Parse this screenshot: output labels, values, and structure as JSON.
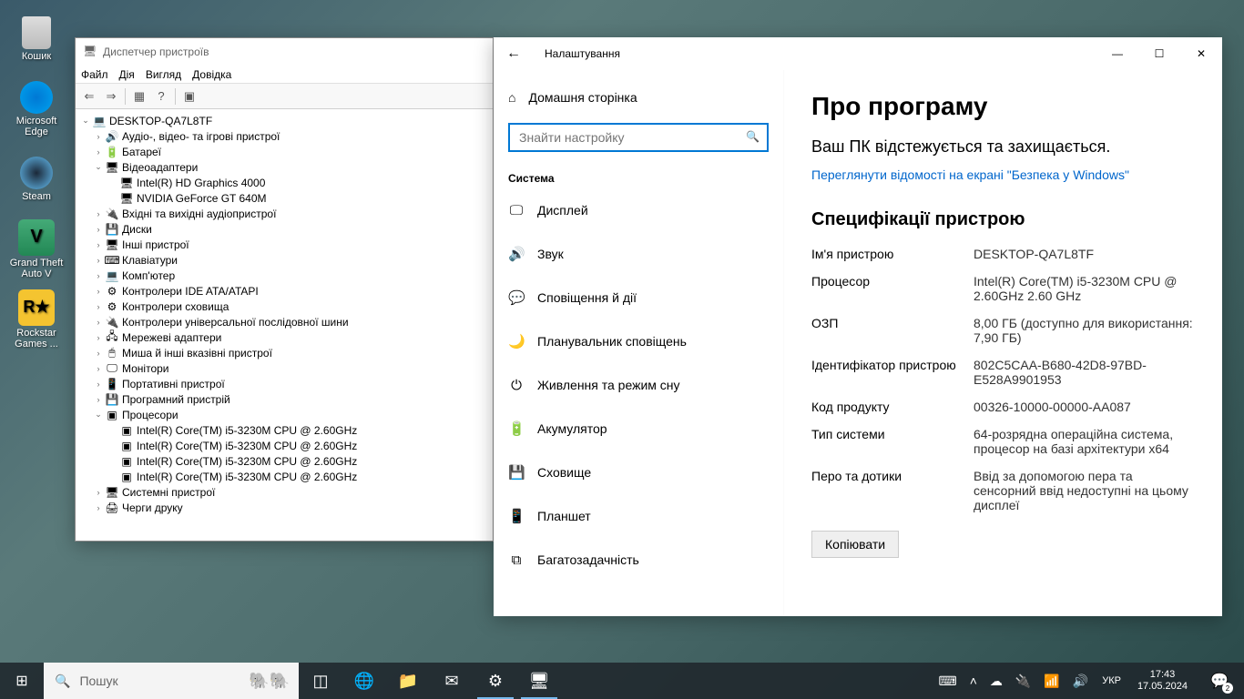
{
  "desktop": {
    "icons": [
      {
        "name": "trash",
        "label": "Кошик",
        "glyph": ""
      },
      {
        "name": "edge",
        "label": "Microsoft Edge",
        "glyph": ""
      },
      {
        "name": "steam",
        "label": "Steam",
        "glyph": ""
      },
      {
        "name": "gta",
        "label": "Grand Theft Auto V",
        "glyph": "V"
      },
      {
        "name": "rockstar",
        "label": "Rockstar Games ...",
        "glyph": "R★"
      }
    ]
  },
  "devmgr": {
    "title": "Диспетчер пристроїв",
    "menu": [
      "Файл",
      "Дія",
      "Вигляд",
      "Довідка"
    ],
    "root": "DESKTOP-QA7L8TF",
    "categories": [
      {
        "arrow": "›",
        "icon": "🔊",
        "label": "Аудіо-, відео- та ігрові пристрої",
        "children": []
      },
      {
        "arrow": "›",
        "icon": "🔋",
        "label": "Батареї",
        "children": []
      },
      {
        "arrow": "⌄",
        "icon": "🖥",
        "label": "Відеоадаптери",
        "children": [
          {
            "icon": "🖥",
            "label": "Intel(R) HD Graphics 4000"
          },
          {
            "icon": "🖥",
            "label": "NVIDIA GeForce GT 640M"
          }
        ]
      },
      {
        "arrow": "›",
        "icon": "🔌",
        "label": "Вхідні та вихідні аудіопристрої",
        "children": []
      },
      {
        "arrow": "›",
        "icon": "💾",
        "label": "Диски",
        "children": []
      },
      {
        "arrow": "›",
        "icon": "🖥",
        "label": "Інші пристрої",
        "children": []
      },
      {
        "arrow": "›",
        "icon": "⌨",
        "label": "Клавіатури",
        "children": []
      },
      {
        "arrow": "›",
        "icon": "💻",
        "label": "Комп'ютер",
        "children": []
      },
      {
        "arrow": "›",
        "icon": "⚙",
        "label": "Контролери IDE ATA/ATAPI",
        "children": []
      },
      {
        "arrow": "›",
        "icon": "⚙",
        "label": "Контролери сховища",
        "children": []
      },
      {
        "arrow": "›",
        "icon": "🔌",
        "label": "Контролери універсальної послідовної шини",
        "children": []
      },
      {
        "arrow": "›",
        "icon": "🖧",
        "label": "Мережеві адаптери",
        "children": []
      },
      {
        "arrow": "›",
        "icon": "🖱",
        "label": "Миша й інші вказівні пристрої",
        "children": []
      },
      {
        "arrow": "›",
        "icon": "🖵",
        "label": "Монітори",
        "children": []
      },
      {
        "arrow": "›",
        "icon": "📱",
        "label": "Портативні пристрої",
        "children": []
      },
      {
        "arrow": "›",
        "icon": "💾",
        "label": "Програмний пристрій",
        "children": []
      },
      {
        "arrow": "⌄",
        "icon": "▣",
        "label": "Процесори",
        "children": [
          {
            "icon": "▣",
            "label": "Intel(R) Core(TM) i5-3230M CPU @ 2.60GHz"
          },
          {
            "icon": "▣",
            "label": "Intel(R) Core(TM) i5-3230M CPU @ 2.60GHz"
          },
          {
            "icon": "▣",
            "label": "Intel(R) Core(TM) i5-3230M CPU @ 2.60GHz"
          },
          {
            "icon": "▣",
            "label": "Intel(R) Core(TM) i5-3230M CPU @ 2.60GHz"
          }
        ]
      },
      {
        "arrow": "›",
        "icon": "🖥",
        "label": "Системні пристрої",
        "children": []
      },
      {
        "arrow": "›",
        "icon": "🖨",
        "label": "Черги друку",
        "children": []
      }
    ]
  },
  "settings": {
    "title": "Налаштування",
    "home": "Домашня сторінка",
    "search_placeholder": "Знайти настройку",
    "section": "Система",
    "nav": [
      {
        "icon": "🖵",
        "label": "Дисплей"
      },
      {
        "icon": "🔊",
        "label": "Звук"
      },
      {
        "icon": "💬",
        "label": "Сповіщення й дії"
      },
      {
        "icon": "🌙",
        "label": "Планувальник сповіщень"
      },
      {
        "icon": "⏻",
        "label": "Живлення та режим сну"
      },
      {
        "icon": "🔋",
        "label": "Акумулятор"
      },
      {
        "icon": "💾",
        "label": "Сховище"
      },
      {
        "icon": "📱",
        "label": "Планшет"
      },
      {
        "icon": "⧉",
        "label": "Багатозадачність"
      }
    ],
    "content": {
      "heading": "Про програму",
      "sub": "Ваш ПК відстежується та захищається.",
      "link": "Переглянути відомості на екрані \"Безпека у Windows\"",
      "specs_title": "Специфікації пристрою",
      "specs": [
        {
          "label": "Ім'я пристрою",
          "value": "DESKTOP-QA7L8TF"
        },
        {
          "label": "Процесор",
          "value": "Intel(R) Core(TM) i5-3230M CPU @ 2.60GHz   2.60 GHz"
        },
        {
          "label": "ОЗП",
          "value": "8,00 ГБ (доступно для використання: 7,90 ГБ)"
        },
        {
          "label": "Ідентифікатор пристрою",
          "value": "802C5CAA-B680-42D8-97BD-E528A9901953"
        },
        {
          "label": "Код продукту",
          "value": "00326-10000-00000-AA087"
        },
        {
          "label": "Тип системи",
          "value": "64-розрядна операційна система, процесор на базі архітектури x64"
        },
        {
          "label": "Перо та дотики",
          "value": "Ввід за допомогою пера та сенсорний ввід недоступні на цьому дисплеї"
        }
      ],
      "copy": "Копіювати"
    }
  },
  "taskbar": {
    "search": "Пошук",
    "lang": "УКР",
    "time": "17:43",
    "date": "17.05.2024",
    "notif_count": "2"
  }
}
